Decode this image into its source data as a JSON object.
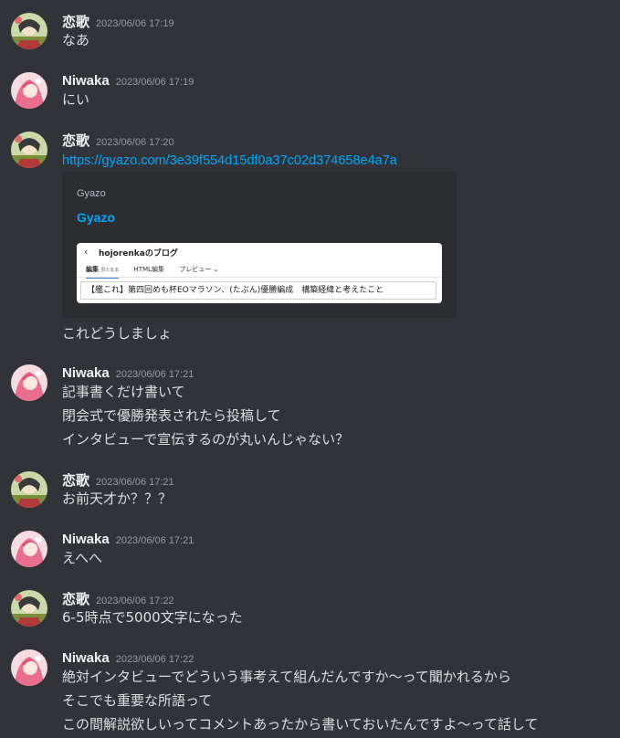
{
  "users": {
    "renka": {
      "name": "恋歌"
    },
    "niwaka": {
      "name": "Niwaka"
    }
  },
  "messages": [
    {
      "author": "恋歌",
      "time": "2023/06/06 17:19",
      "lines": [
        "なあ"
      ]
    },
    {
      "author": "Niwaka",
      "time": "2023/06/06 17:19",
      "lines": [
        "にい"
      ]
    },
    {
      "author": "恋歌",
      "time": "2023/06/06 17:20",
      "link": "https://gyazo.com/3e39f554d15df0a37c02d374658e4a7a",
      "embed": {
        "provider": "Gyazo",
        "title": "Gyazo",
        "image": {
          "back_icon": "‹",
          "blog_title": "hojorenkaのブログ",
          "tabs": [
            {
              "label": "編集",
              "sub": "見たまま"
            },
            {
              "label": "HTML編集"
            },
            {
              "label": "プレビュー ⌄"
            }
          ],
          "post_title": "【艦これ】第四回めも杯EOマラソン、(たぶん)優勝編成　構築経緯と考えたこと"
        }
      },
      "lines": [
        "これどうしましょ"
      ]
    },
    {
      "author": "Niwaka",
      "time": "2023/06/06 17:21",
      "lines": [
        "記事書くだけ書いて",
        "閉会式で優勝発表されたら投稿して",
        "インタビューで宣伝するのが丸いんじゃない？"
      ]
    },
    {
      "author": "恋歌",
      "time": "2023/06/06 17:21",
      "lines": [
        "お前天才か？？？"
      ]
    },
    {
      "author": "Niwaka",
      "time": "2023/06/06 17:21",
      "lines": [
        "えへへ"
      ]
    },
    {
      "author": "恋歌",
      "time": "2023/06/06 17:22",
      "lines": [
        "6-5時点で5000文字になった"
      ]
    },
    {
      "author": "Niwaka",
      "time": "2023/06/06 17:22",
      "lines": [
        "絶対インタビューでどういう事考えて組んだんですか～って聞かれるから",
        "そこでも重要な所語って",
        "この間解説欲しいってコメントあったから書いておいたんですよ～って話して"
      ]
    }
  ],
  "colors": {
    "background": "#313338",
    "username": "#f2f3f5",
    "timestamp": "#949ba4",
    "text": "#dbdee1",
    "link": "#00a8fc",
    "embed_bg": "#2b2d31"
  },
  "icons": {
    "renka_avatar": "anime-avatar-icon",
    "niwaka_avatar": "anime-avatar-icon"
  }
}
